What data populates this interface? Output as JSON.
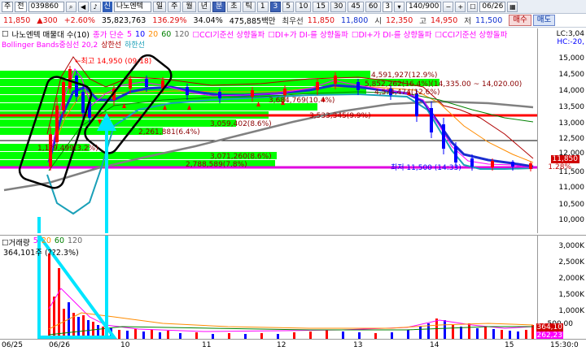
{
  "toolbar": {
    "market": "주",
    "prev": "전",
    "code": "039860",
    "shin": "신",
    "stock_name": "나노엔텍",
    "periods": [
      "일",
      "주",
      "월",
      "년",
      "분",
      "초",
      "틱"
    ],
    "selected_period": "분",
    "minutes": [
      "1",
      "3",
      "5",
      "10",
      "15",
      "30",
      "45",
      "60"
    ],
    "selected_minute": "3",
    "count_box": "3",
    "range": "140/900",
    "date": "06/26"
  },
  "quote": {
    "price": "11,850",
    "change": "300",
    "change_pct": "+2.60%",
    "volume": "35,823,763",
    "vol_ratio": "136.29%",
    "turnover_pct": "34.04%",
    "amount": "475,885백만",
    "best_ask_label": "최우선",
    "best_ask": "11,850",
    "best_bid": "11,800",
    "open_label": "시",
    "open": "12,350",
    "high_label": "고",
    "high": "14,950",
    "low_label": "저",
    "low": "11,500",
    "buy_label": "매수",
    "sell_label": "매도"
  },
  "legend": {
    "main": "나노엔텍 매물대 수(10)",
    "ma_label": "종가 단순",
    "ma_periods": [
      "5",
      "10",
      "20",
      "60",
      "120"
    ],
    "ma_colors": [
      "#ff00ff",
      "#0000ff",
      "#ff8c00",
      "#008000",
      "#666666"
    ],
    "signals": [
      "CCI기준선 상향돌파",
      "DI+가 DI-를 상향돌파",
      "DI+가 DI-를 상향돌파",
      "CCI기준선 상향돌파"
    ],
    "bollinger": "Bollinger Bands중심선 20,2",
    "upper": "상한선",
    "lower": "하한선"
  },
  "price_axis": {
    "labels": [
      "15,000",
      "14,500",
      "14,000",
      "13,500",
      "13,000",
      "12,500",
      "12,000",
      "11,500",
      "11,000",
      "10,500",
      "10,000"
    ],
    "top_right_1": "LC:3,04",
    "top_right_2": "HC:-20,",
    "current_price": "11,850",
    "current_pct": "1.28%"
  },
  "annotations": {
    "high_marker": "←최고 14,950 (09:18)",
    "low_marker": "최저 11,500 (14:33)",
    "volume_profile": [
      "4,591,927(12.9%)",
      "5,852,262(16.4%)(14,335.00 ~ 14,020.00)",
      "4,5?4,474(12.6%)",
      "3,684,769(10.4%)",
      "3,059,402(8.6%)",
      "2,261,881(6.4%)",
      "1,1?9,499(3.2%)",
      "3,071,260(8.6%)",
      "2,788,589(7.8%)",
      "3,533,345(9.9%)"
    ]
  },
  "volume": {
    "title": "거래량",
    "periods": [
      "5",
      "20",
      "60",
      "120"
    ],
    "summary": "364,101주 (??2.3%)",
    "axis": [
      "3,000K",
      "2,500K",
      "2,000K",
      "1,500K",
      "1,000K",
      "500,00"
    ],
    "last_1": "364,10",
    "last_2": "262,23"
  },
  "dates": {
    "labels": [
      "06/25",
      "06/26",
      "10",
      "11",
      "12",
      "13",
      "14",
      "15"
    ],
    "time": "15:30:0"
  }
}
